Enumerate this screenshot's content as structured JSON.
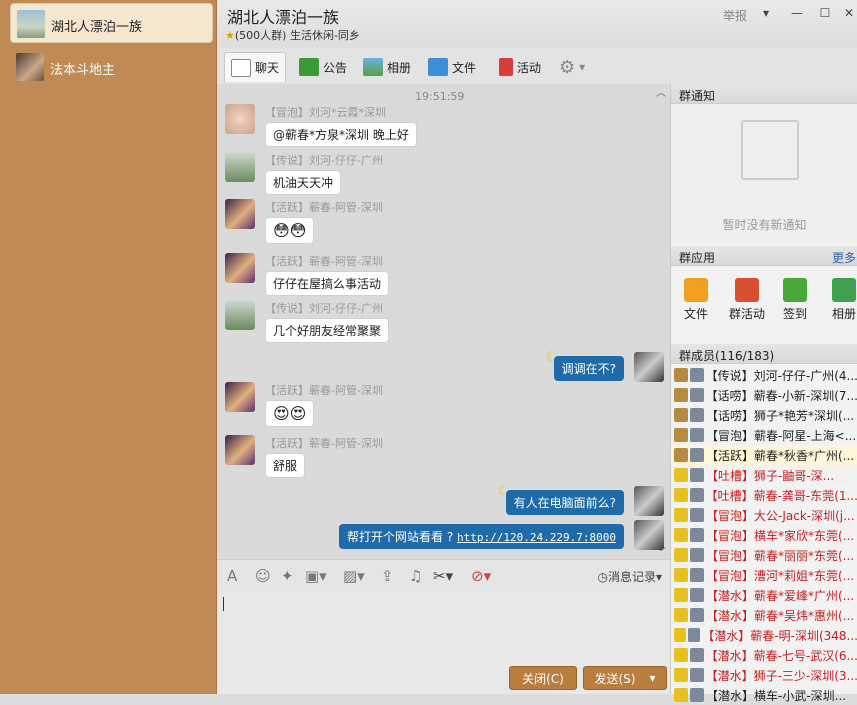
{
  "sidebar": {
    "items": [
      {
        "label": "湖北人漂泊一族"
      },
      {
        "label": "法本斗地主"
      }
    ]
  },
  "header": {
    "title": "湖北人漂泊一族",
    "subtitle": "(500人群) 生活休闲-同乡",
    "report": "举报",
    "min": "▾",
    "minimize": "—",
    "maximize": "☐",
    "close": "✕"
  },
  "tabs": [
    {
      "label": "聊天"
    },
    {
      "label": "公告"
    },
    {
      "label": "相册"
    },
    {
      "label": "文件"
    },
    {
      "label": "活动"
    }
  ],
  "chat": {
    "timestamp": "19:51:59",
    "messages": [
      {
        "sender": "【冒泡】刘河*云霞*深圳",
        "text": "@蕲春*方泉*深圳  晚上好"
      },
      {
        "sender": "【传说】刘河-仔仔-广州",
        "text": "机油天天冲"
      },
      {
        "sender": "【活跃】蕲春-阿管-深圳",
        "text": "😳😳"
      },
      {
        "sender": "【活跃】蕲春-阿管-深圳",
        "text": "仔仔在屋搞么事活动"
      },
      {
        "sender": "【传说】刘河-仔仔-广州",
        "text": "几个好朋友经常聚聚"
      },
      {
        "sender": "【活跃】蕲春-阿管-深圳",
        "text": "😍😍"
      },
      {
        "sender": "【活跃】蕲春-阿管-深圳",
        "text": "舒服"
      }
    ],
    "self": [
      {
        "text": "调调在不?"
      },
      {
        "text": "有人在电脑面前么?"
      },
      {
        "text": "帮打开个网站看看 ?",
        "link": "http://120.24.229.7:8000"
      }
    ]
  },
  "toolbar": {
    "history": "消息记录"
  },
  "buttons": {
    "close": "关闭(C)",
    "send": "发送(S)"
  },
  "notice": {
    "title": "群通知",
    "empty": "暂时没有新通知"
  },
  "apps": {
    "title": "群应用",
    "more": "更多",
    "items": [
      {
        "label": "文件"
      },
      {
        "label": "群活动"
      },
      {
        "label": "签到"
      },
      {
        "label": "相册"
      }
    ]
  },
  "members": {
    "title": "群成员(116/183)",
    "list": [
      {
        "name": "【传说】刘河-仔仔-广州(4...",
        "color": "#222"
      },
      {
        "name": "【话唠】蕲春-小新-深圳(7...",
        "color": "#222"
      },
      {
        "name": "【话唠】狮子*艳芳*深圳(...",
        "color": "#222"
      },
      {
        "name": "【冒泡】蕲春-阿星-上海<...",
        "color": "#222"
      },
      {
        "name": "【活跃】蕲春*秋香*广州(...",
        "color": "#222"
      },
      {
        "name": "【吐槽】狮子-鼬哥-深...",
        "color": "#c62020"
      },
      {
        "name": "【吐槽】蕲春-龚哥-东莞(1...",
        "color": "#c62020"
      },
      {
        "name": "【冒泡】大公-Jack-深圳(j...",
        "color": "#c62020"
      },
      {
        "name": "【冒泡】横车*家欣*东莞(...",
        "color": "#c62020"
      },
      {
        "name": "【冒泡】蕲春*丽丽*东莞(...",
        "color": "#c62020"
      },
      {
        "name": "【冒泡】漕河*莉姐*东莞(...",
        "color": "#c62020"
      },
      {
        "name": "【潜水】蕲春*爱峰*广州(...",
        "color": "#c62020"
      },
      {
        "name": "【潜水】蕲春*吴炜*惠州(...",
        "color": "#c62020"
      },
      {
        "name": "【潜水】蕲春-明-深圳(348...",
        "color": "#c62020"
      },
      {
        "name": "【潜水】蕲春-七号-武汉(6...",
        "color": "#c62020"
      },
      {
        "name": "【潜水】狮子-三少-深圳(3...",
        "color": "#c62020"
      },
      {
        "name": "【潜水】横车-小武-深圳...",
        "color": "#222"
      }
    ]
  }
}
